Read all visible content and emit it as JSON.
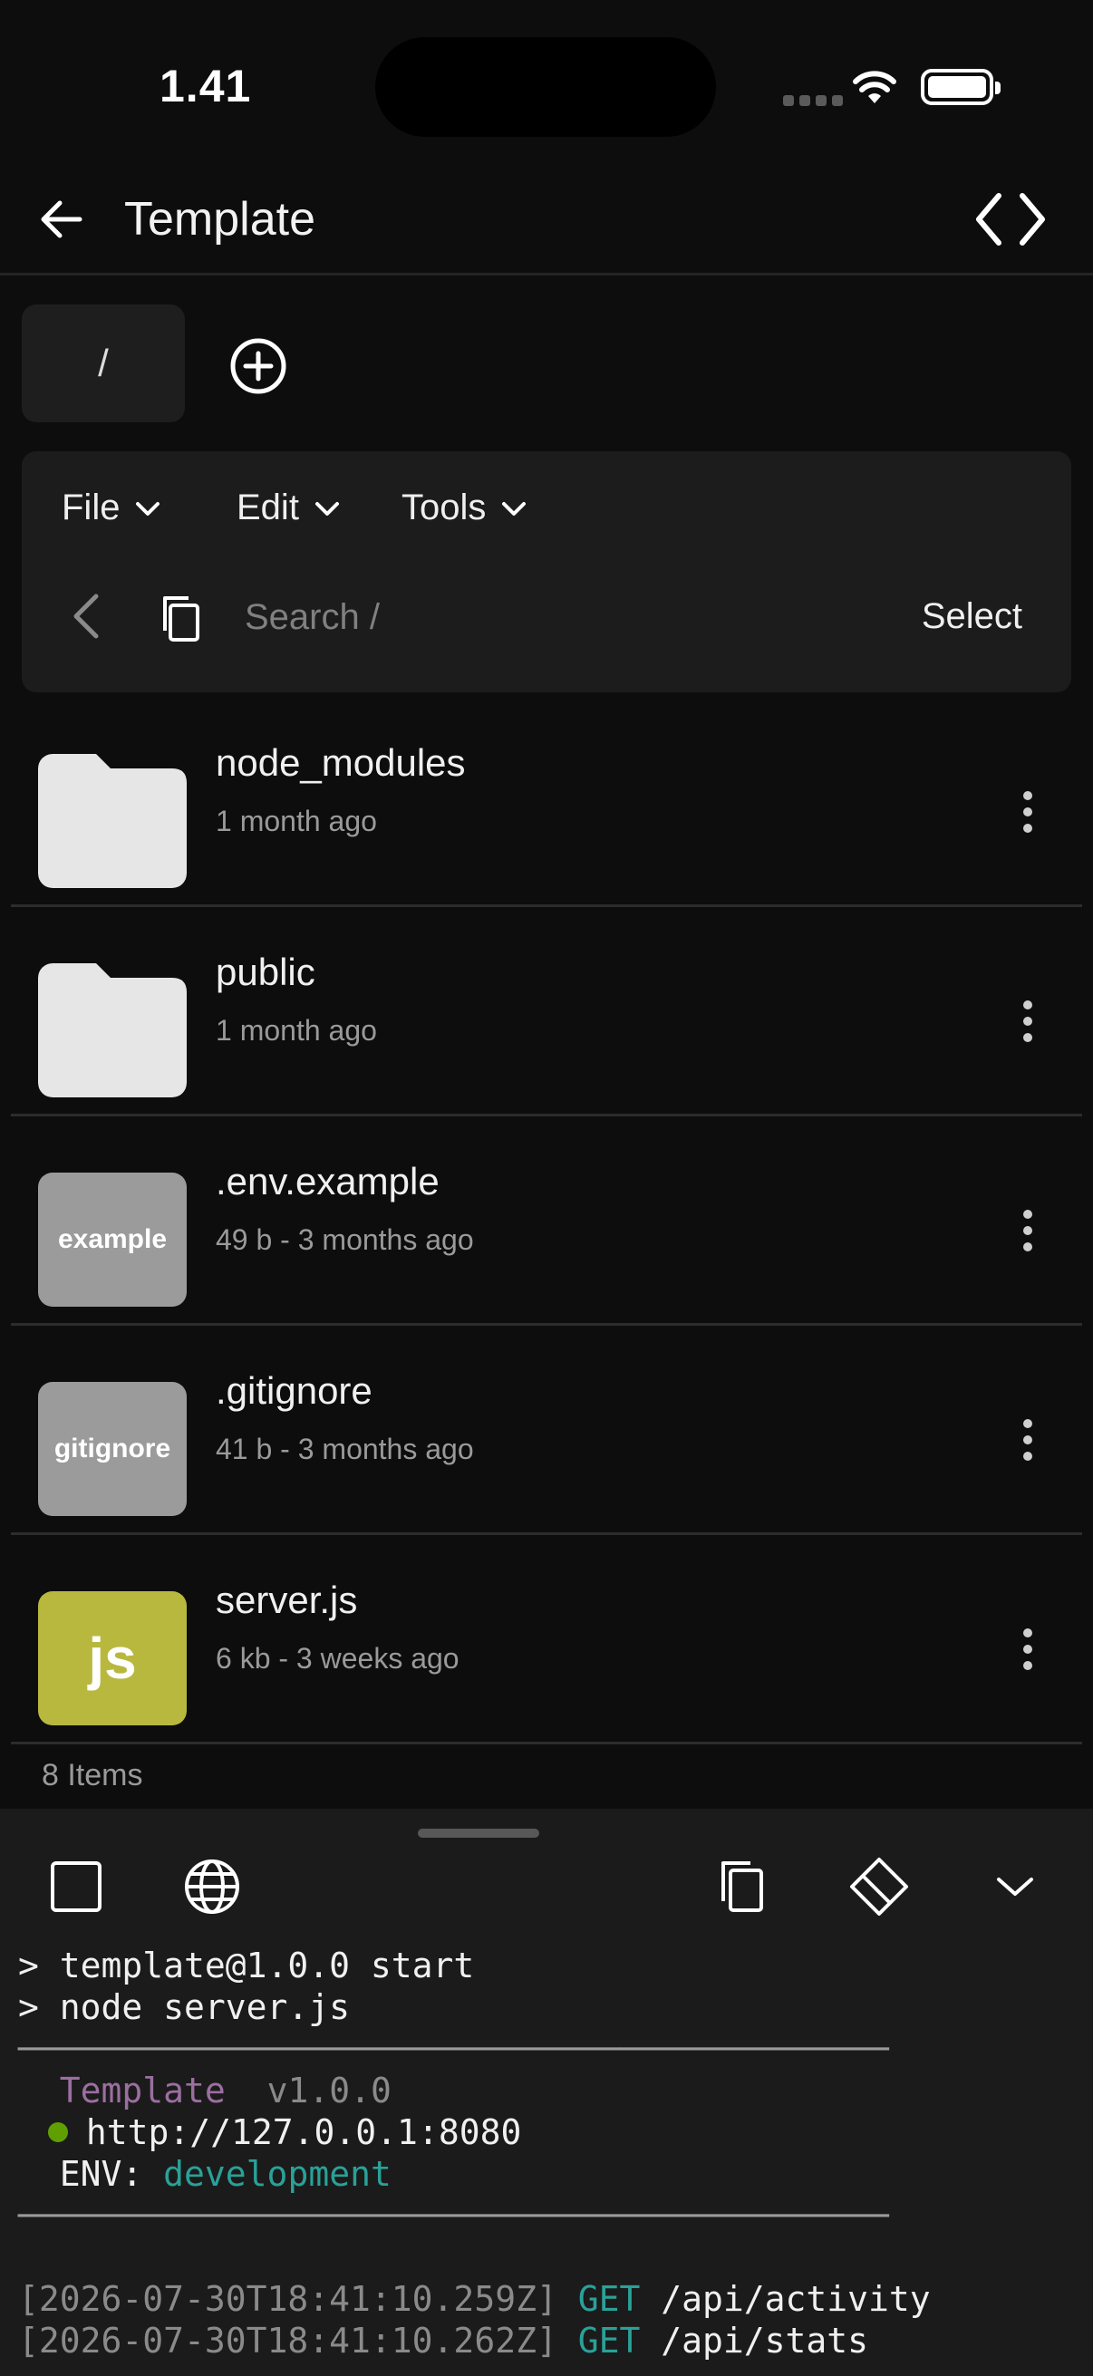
{
  "status_bar": {
    "time": "1.41"
  },
  "header": {
    "title": "Template"
  },
  "path": {
    "current": "/"
  },
  "toolbar": {
    "menus": [
      {
        "label": "File"
      },
      {
        "label": "Edit"
      },
      {
        "label": "Tools"
      }
    ],
    "search_placeholder": "Search /",
    "select_label": "Select"
  },
  "files": [
    {
      "name": "node_modules",
      "meta": "1 month ago",
      "type": "folder",
      "thumb_label": ""
    },
    {
      "name": "public",
      "meta": "1 month ago",
      "type": "folder",
      "thumb_label": ""
    },
    {
      "name": ".env.example",
      "meta": "49 b - 3 months ago",
      "type": "file",
      "thumb_label": "example"
    },
    {
      "name": ".gitignore",
      "meta": "41 b - 3 months ago",
      "type": "file",
      "thumb_label": "gitignore"
    },
    {
      "name": "server.js",
      "meta": "6 kb - 3 weeks ago",
      "type": "js",
      "thumb_label": "js"
    }
  ],
  "item_count": "8 Items",
  "terminal": {
    "lines": {
      "cmd1": "> template@1.0.0 start",
      "cmd2": "> node server.js",
      "divider": "──────────────────────────────────────────",
      "app_name": "Template",
      "version": "v1.0.0",
      "url": "http://127.0.0.1:8080",
      "env_label": "ENV:",
      "env_value": "development",
      "log1_ts": "[2026-07-30T18:41:10.259Z]",
      "log1_method": "GET",
      "log1_path": "/api/activity",
      "log2_ts": "[2026-07-30T18:41:10.262Z]",
      "log2_method": "GET",
      "log2_path": "/api/stats"
    }
  },
  "colors": {
    "accent_js": "#b8b83f",
    "file_thumb_gray": "#9b9b9b",
    "terminal_purple": "#9b6fa0",
    "terminal_teal": "#2aa198",
    "status_dot_green": "#5fa000"
  }
}
